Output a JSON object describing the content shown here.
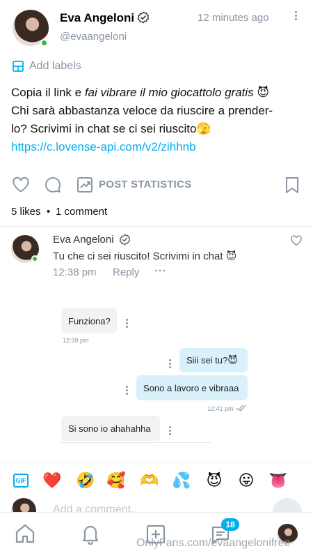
{
  "post": {
    "author_name": "Eva Angeloni",
    "author_handle": "@evaangeloni",
    "timestamp": "12 minutes ago",
    "add_labels": "Add labels",
    "text_line1_a": "Copia il link e ",
    "text_line1_b": "fai vibrare il mio giocattolo gratis",
    "text_line2": "Chi sarà abbastanza veloce da riuscire a prender-",
    "text_line3": "lo? Scrivimi in chat se ci sei riuscito",
    "link": "https://c.lovense-api.com/v2/zihhnb",
    "post_statistics": "POST STATISTICS",
    "likes": "5 likes",
    "separator": "•",
    "comments_count": "1 comment"
  },
  "comment": {
    "author_name": "Eva Angeloni",
    "text": "Tu che ci sei riuscito! Scrivimi in chat",
    "time": "12:38 pm",
    "reply": "Reply"
  },
  "chat": {
    "messages": [
      {
        "text": "Funziona?",
        "time": "12:39 pm"
      },
      {
        "text": "Siii sei tu?"
      },
      {
        "text": "Sono a lavoro e vibraaa",
        "time": "12:41 pm"
      },
      {
        "text": "Si sono io ahahahha"
      }
    ]
  },
  "emoji_bar": {
    "gif_label": "GIF",
    "emojis": [
      "❤️",
      "🤣",
      "🥰",
      "🫶",
      "💦",
      "😈",
      "😛",
      "👅"
    ]
  },
  "comment_input": {
    "placeholder": "Add a comment..."
  },
  "bottom_nav": {
    "badge": "18",
    "watermark": "OnlyFans.com/evaangelonifree"
  },
  "colors": {
    "accent": "#00aff0",
    "muted": "#8a96a3",
    "online": "#3bb54a"
  }
}
